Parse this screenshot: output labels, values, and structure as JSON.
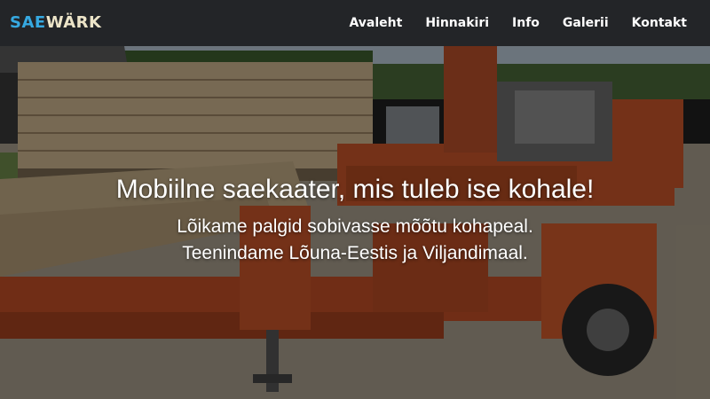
{
  "brand": {
    "part1": "SAE",
    "part2": "WÄRK"
  },
  "nav": {
    "items": [
      "Avaleht",
      "Hinnakiri",
      "Info",
      "Galerii",
      "Kontakt"
    ]
  },
  "hero": {
    "headline": "Mobiilne saekaater, mis tuleb ise kohale!",
    "line1": "Lõikame palgid sobivasse mõõtu kohapeal.",
    "line2": "Teenindame Lõuna-Eestis ja Viljandimaal."
  },
  "colors": {
    "navbar_bg": "#232528",
    "brand_accent": "#36a9e1",
    "brand_light": "#ece4c8",
    "sawmill_orange": "#c9552a"
  }
}
